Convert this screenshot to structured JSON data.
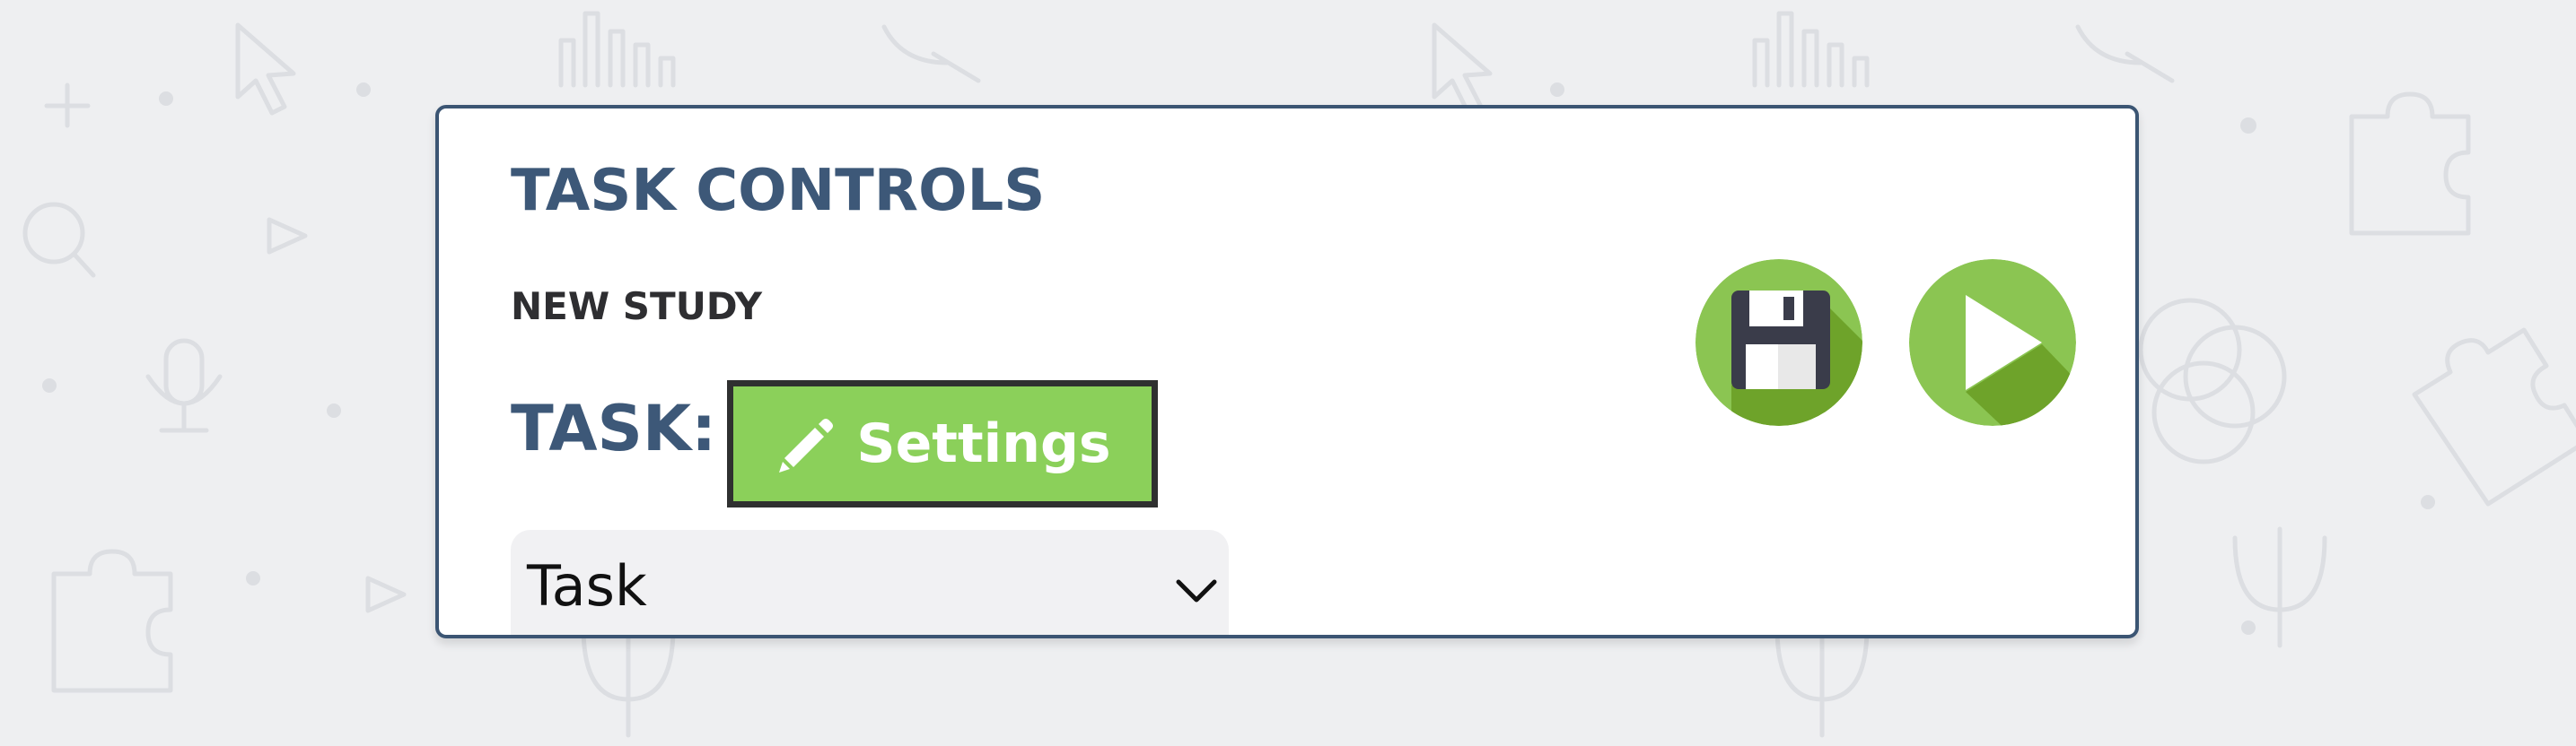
{
  "panel": {
    "title": "TASK CONTROLS",
    "subtitle": "NEW STUDY",
    "task_label": "TASK:"
  },
  "settings_button": {
    "label": "Settings",
    "icon": "pencil-icon"
  },
  "task_select": {
    "selected": "Task",
    "icon": "chevron-down-icon"
  },
  "actions": {
    "save_icon": "floppy-disk-icon",
    "play_icon": "play-icon"
  },
  "colors": {
    "title": "#3d5878",
    "accent_green": "#8bd05a",
    "dark_green": "#6ea32a",
    "panel_border": "#3b5573",
    "background": "#eeeff1"
  }
}
